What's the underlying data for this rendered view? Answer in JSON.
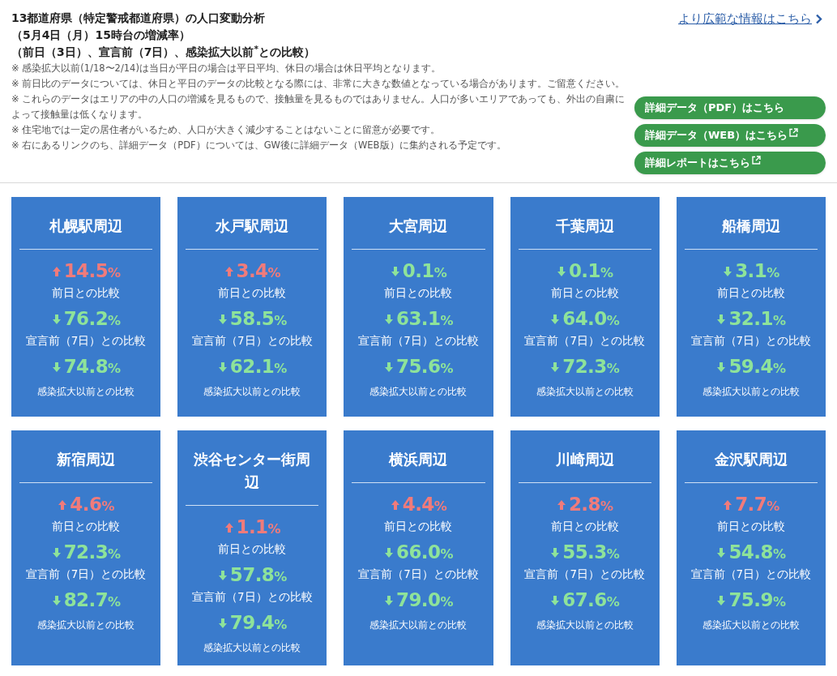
{
  "header": {
    "title_lines": [
      "13都道府県（特定警戒都道府県）の人口変動分析",
      "（5月4日（月）15時台の増減率）",
      "（前日（3日）、宣言前（7日）、感染拡大以前$^{*}$との比較）"
    ],
    "notes": [
      "※ 感染拡大以前(1/18〜2/14)は当日が平日の場合は平日平均、休日の場合は休日平均となります。",
      "※ 前日比のデータについては、休日と平日のデータの比較となる際には、非常に大きな数値となっている場合があります。ご留意ください。",
      "※ これらのデータはエリアの中の人口の増減を見るもので、接触量を見るものではありません。人口が多いエリアであっても、外出の自粛によって接触量は低くなります。",
      "※ 住宅地では一定の居住者がいるため、人口が大きく減少することはないことに留意が必要です。",
      "※ 右にあるリンクのち、詳細データ（PDF）については、GW後に詳細データ（WEB版）に集約される予定です。"
    ],
    "more_link": "より広範な情報はこちら",
    "buttons": [
      {
        "label": "詳細データ（PDF）はこちら",
        "external": false
      },
      {
        "label": "詳細データ（WEB）はこちら",
        "external": true
      },
      {
        "label": "詳細レポートはこちら",
        "external": true
      }
    ]
  },
  "areas": [
    {
      "name": "札幌駅周辺",
      "metrics": [
        {
          "rising": true,
          "value": "14.5",
          "unit": "%",
          "label": "前日との比較"
        },
        {
          "rising": false,
          "value": "76.2",
          "unit": "%",
          "label": "宣言前（7日）との比較"
        },
        {
          "rising": false,
          "value": "74.8",
          "unit": "%",
          "label": "感染拡大以前との比較"
        }
      ]
    },
    {
      "name": "水戸駅周辺",
      "metrics": [
        {
          "rising": true,
          "value": "3.4",
          "unit": "%",
          "label": "前日との比較"
        },
        {
          "rising": false,
          "value": "58.5",
          "unit": "%",
          "label": "宣言前（7日）との比較"
        },
        {
          "rising": false,
          "value": "62.1",
          "unit": "%",
          "label": "感染拡大以前との比較"
        }
      ]
    },
    {
      "name": "大宮周辺",
      "metrics": [
        {
          "rising": false,
          "value": "0.1",
          "unit": "%",
          "label": "前日との比較"
        },
        {
          "rising": false,
          "value": "63.1",
          "unit": "%",
          "label": "宣言前（7日）との比較"
        },
        {
          "rising": false,
          "value": "75.6",
          "unit": "%",
          "label": "感染拡大以前との比較"
        }
      ]
    },
    {
      "name": "千葉周辺",
      "metrics": [
        {
          "rising": false,
          "value": "0.1",
          "unit": "%",
          "label": "前日との比較"
        },
        {
          "rising": false,
          "value": "64.0",
          "unit": "%",
          "label": "宣言前（7日）との比較"
        },
        {
          "rising": false,
          "value": "72.3",
          "unit": "%",
          "label": "感染拡大以前との比較"
        }
      ]
    },
    {
      "name": "船橋周辺",
      "metrics": [
        {
          "rising": false,
          "value": "3.1",
          "unit": "%",
          "label": "前日との比較"
        },
        {
          "rising": false,
          "value": "32.1",
          "unit": "%",
          "label": "宣言前（7日）との比較"
        },
        {
          "rising": false,
          "value": "59.4",
          "unit": "%",
          "label": "感染拡大以前との比較"
        }
      ]
    },
    {
      "name": "新宿周辺",
      "metrics": [
        {
          "rising": true,
          "value": "4.6",
          "unit": "%",
          "label": "前日との比較"
        },
        {
          "rising": false,
          "value": "72.3",
          "unit": "%",
          "label": "宣言前（7日）との比較"
        },
        {
          "rising": false,
          "value": "82.7",
          "unit": "%",
          "label": "感染拡大以前との比較"
        }
      ]
    },
    {
      "name": "渋谷センター街周辺",
      "metrics": [
        {
          "rising": true,
          "value": "1.1",
          "unit": "%",
          "label": "前日との比較"
        },
        {
          "rising": false,
          "value": "57.8",
          "unit": "%",
          "label": "宣言前（7日）との比較"
        },
        {
          "rising": false,
          "value": "79.4",
          "unit": "%",
          "label": "感染拡大以前との比較"
        }
      ]
    },
    {
      "name": "横浜周辺",
      "metrics": [
        {
          "rising": true,
          "value": "4.4",
          "unit": "%",
          "label": "前日との比較"
        },
        {
          "rising": false,
          "value": "66.0",
          "unit": "%",
          "label": "宣言前（7日）との比較"
        },
        {
          "rising": false,
          "value": "79.0",
          "unit": "%",
          "label": "感染拡大以前との比較"
        }
      ]
    },
    {
      "name": "川崎周辺",
      "metrics": [
        {
          "rising": true,
          "value": "2.8",
          "unit": "%",
          "label": "前日との比較"
        },
        {
          "rising": false,
          "value": "55.3",
          "unit": "%",
          "label": "宣言前（7日）との比較"
        },
        {
          "rising": false,
          "value": "67.6",
          "unit": "%",
          "label": "感染拡大以前との比較"
        }
      ]
    },
    {
      "name": "金沢駅周辺",
      "metrics": [
        {
          "rising": true,
          "value": "7.7",
          "unit": "%",
          "label": "前日との比較"
        },
        {
          "rising": false,
          "value": "54.8",
          "unit": "%",
          "label": "宣言前（7日）との比較"
        },
        {
          "rising": false,
          "value": "75.9",
          "unit": "%",
          "label": "感染拡大以前との比較"
        }
      ]
    }
  ]
}
